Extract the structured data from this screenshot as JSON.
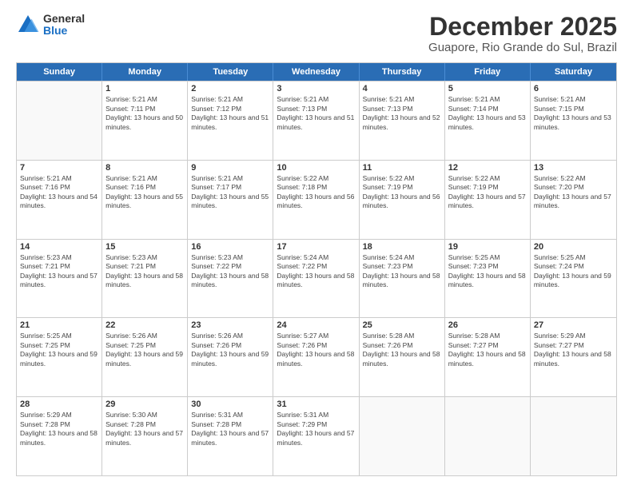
{
  "logo": {
    "general": "General",
    "blue": "Blue"
  },
  "header": {
    "month": "December 2025",
    "location": "Guapore, Rio Grande do Sul, Brazil"
  },
  "weekdays": [
    "Sunday",
    "Monday",
    "Tuesday",
    "Wednesday",
    "Thursday",
    "Friday",
    "Saturday"
  ],
  "rows": [
    [
      {
        "day": "",
        "empty": true
      },
      {
        "day": "1",
        "sunrise": "5:21 AM",
        "sunset": "7:11 PM",
        "daylight": "13 hours and 50 minutes."
      },
      {
        "day": "2",
        "sunrise": "5:21 AM",
        "sunset": "7:12 PM",
        "daylight": "13 hours and 51 minutes."
      },
      {
        "day": "3",
        "sunrise": "5:21 AM",
        "sunset": "7:13 PM",
        "daylight": "13 hours and 51 minutes."
      },
      {
        "day": "4",
        "sunrise": "5:21 AM",
        "sunset": "7:13 PM",
        "daylight": "13 hours and 52 minutes."
      },
      {
        "day": "5",
        "sunrise": "5:21 AM",
        "sunset": "7:14 PM",
        "daylight": "13 hours and 53 minutes."
      },
      {
        "day": "6",
        "sunrise": "5:21 AM",
        "sunset": "7:15 PM",
        "daylight": "13 hours and 53 minutes."
      }
    ],
    [
      {
        "day": "7",
        "sunrise": "5:21 AM",
        "sunset": "7:16 PM",
        "daylight": "13 hours and 54 minutes."
      },
      {
        "day": "8",
        "sunrise": "5:21 AM",
        "sunset": "7:16 PM",
        "daylight": "13 hours and 55 minutes."
      },
      {
        "day": "9",
        "sunrise": "5:21 AM",
        "sunset": "7:17 PM",
        "daylight": "13 hours and 55 minutes."
      },
      {
        "day": "10",
        "sunrise": "5:22 AM",
        "sunset": "7:18 PM",
        "daylight": "13 hours and 56 minutes."
      },
      {
        "day": "11",
        "sunrise": "5:22 AM",
        "sunset": "7:19 PM",
        "daylight": "13 hours and 56 minutes."
      },
      {
        "day": "12",
        "sunrise": "5:22 AM",
        "sunset": "7:19 PM",
        "daylight": "13 hours and 57 minutes."
      },
      {
        "day": "13",
        "sunrise": "5:22 AM",
        "sunset": "7:20 PM",
        "daylight": "13 hours and 57 minutes."
      }
    ],
    [
      {
        "day": "14",
        "sunrise": "5:23 AM",
        "sunset": "7:21 PM",
        "daylight": "13 hours and 57 minutes."
      },
      {
        "day": "15",
        "sunrise": "5:23 AM",
        "sunset": "7:21 PM",
        "daylight": "13 hours and 58 minutes."
      },
      {
        "day": "16",
        "sunrise": "5:23 AM",
        "sunset": "7:22 PM",
        "daylight": "13 hours and 58 minutes."
      },
      {
        "day": "17",
        "sunrise": "5:24 AM",
        "sunset": "7:22 PM",
        "daylight": "13 hours and 58 minutes."
      },
      {
        "day": "18",
        "sunrise": "5:24 AM",
        "sunset": "7:23 PM",
        "daylight": "13 hours and 58 minutes."
      },
      {
        "day": "19",
        "sunrise": "5:25 AM",
        "sunset": "7:23 PM",
        "daylight": "13 hours and 58 minutes."
      },
      {
        "day": "20",
        "sunrise": "5:25 AM",
        "sunset": "7:24 PM",
        "daylight": "13 hours and 59 minutes."
      }
    ],
    [
      {
        "day": "21",
        "sunrise": "5:25 AM",
        "sunset": "7:25 PM",
        "daylight": "13 hours and 59 minutes."
      },
      {
        "day": "22",
        "sunrise": "5:26 AM",
        "sunset": "7:25 PM",
        "daylight": "13 hours and 59 minutes."
      },
      {
        "day": "23",
        "sunrise": "5:26 AM",
        "sunset": "7:26 PM",
        "daylight": "13 hours and 59 minutes."
      },
      {
        "day": "24",
        "sunrise": "5:27 AM",
        "sunset": "7:26 PM",
        "daylight": "13 hours and 58 minutes."
      },
      {
        "day": "25",
        "sunrise": "5:28 AM",
        "sunset": "7:26 PM",
        "daylight": "13 hours and 58 minutes."
      },
      {
        "day": "26",
        "sunrise": "5:28 AM",
        "sunset": "7:27 PM",
        "daylight": "13 hours and 58 minutes."
      },
      {
        "day": "27",
        "sunrise": "5:29 AM",
        "sunset": "7:27 PM",
        "daylight": "13 hours and 58 minutes."
      }
    ],
    [
      {
        "day": "28",
        "sunrise": "5:29 AM",
        "sunset": "7:28 PM",
        "daylight": "13 hours and 58 minutes."
      },
      {
        "day": "29",
        "sunrise": "5:30 AM",
        "sunset": "7:28 PM",
        "daylight": "13 hours and 57 minutes."
      },
      {
        "day": "30",
        "sunrise": "5:31 AM",
        "sunset": "7:28 PM",
        "daylight": "13 hours and 57 minutes."
      },
      {
        "day": "31",
        "sunrise": "5:31 AM",
        "sunset": "7:29 PM",
        "daylight": "13 hours and 57 minutes."
      },
      {
        "day": "",
        "empty": true
      },
      {
        "day": "",
        "empty": true
      },
      {
        "day": "",
        "empty": true
      }
    ]
  ]
}
